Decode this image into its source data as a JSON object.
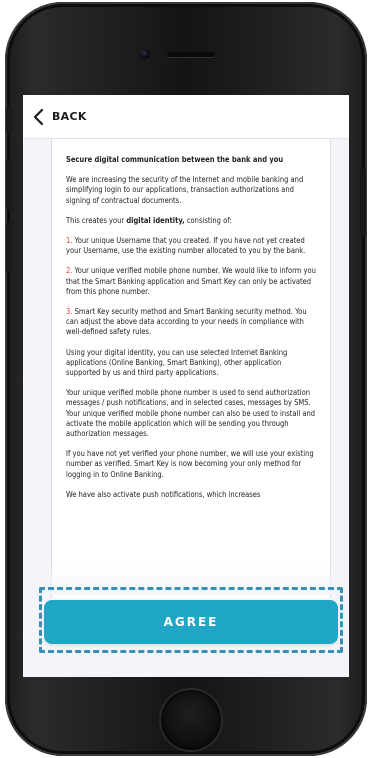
{
  "header": {
    "back_label": "BACK",
    "back_icon": "chevron-left-icon"
  },
  "document": {
    "title": "Secure digital communication between the bank and you",
    "intro": "We are increasing the security of the Internet and mobile banking and simplifying login to our applications, transaction authorizations and signing of contractual documents.",
    "identity_pre": "This creates your ",
    "identity_bold": "digital identity,",
    "identity_post": " consisting of:",
    "items": [
      {
        "num": "1.",
        "text": " Your unique Username that you created. If you have not yet created your Username, use the existing number allocated to you by the bank."
      },
      {
        "num": "2.",
        "text": " Your unique verified mobile phone number. We would like to inform you that the Smart Banking application and Smart Key can only be activated from this phone number."
      },
      {
        "num": "3.",
        "text": " Smart Key security method and Smart Banking security method. You can adjust the above data according to your needs in compliance with well-defined safety rules."
      }
    ],
    "para_usage": "Using your digital identity, you can use selected Internet Banking applications (Online Banking, Smart Banking), other application supported by us and third party applications.",
    "para_phone": "Your unique verified mobile phone number is used to send authorization messages / push notifications, and in selected cases, messages by SMS. Your unique verified mobile phone number can also be used to install and activate the mobile application which will be sending you through authorization messages.",
    "para_notverified": "If you have not yet verified your phone number, we will use your existing number as verified. Smart Key is now becoming your only method for logging in to Online Banking.",
    "para_push": "We have also activate push notifications, which increases"
  },
  "agree": {
    "label": "AGREE"
  },
  "colors": {
    "accent": "#21a7c6",
    "highlight_frame": "#3a8fb7",
    "number_red": "#e03b3b"
  }
}
